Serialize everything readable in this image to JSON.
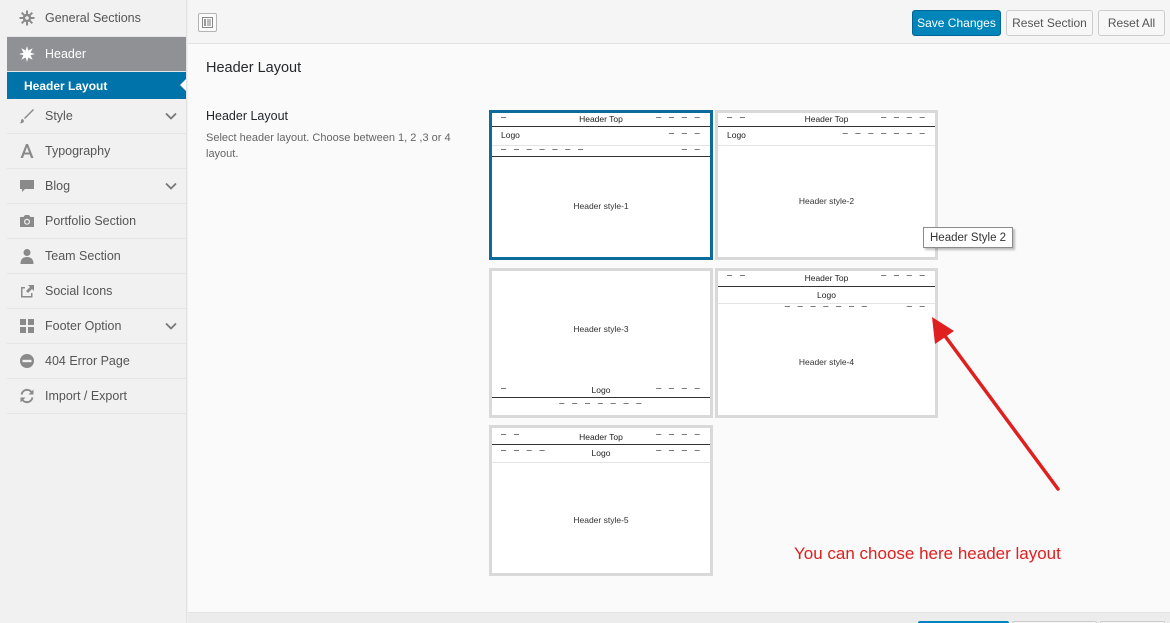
{
  "sidebar": {
    "items": [
      {
        "label": "General Sections",
        "icon": "gear-icon"
      },
      {
        "label": "Header",
        "icon": "burst-icon"
      },
      {
        "label": "Style",
        "icon": "brush-icon"
      },
      {
        "label": "Typography",
        "icon": "typography-icon"
      },
      {
        "label": "Blog",
        "icon": "comment-icon"
      },
      {
        "label": "Portfolio Section",
        "icon": "camera-icon"
      },
      {
        "label": "Team Section",
        "icon": "person-icon"
      },
      {
        "label": "Social Icons",
        "icon": "share-icon"
      },
      {
        "label": "Footer Option",
        "icon": "grid-icon"
      },
      {
        "label": "404 Error Page",
        "icon": "no-entry-icon"
      },
      {
        "label": "Import / Export",
        "icon": "refresh-icon"
      }
    ],
    "sub_item": {
      "label": "Header Layout"
    }
  },
  "toolbar": {
    "save_label": "Save Changes",
    "reset_section_label": "Reset Section",
    "reset_all_label": "Reset All"
  },
  "main": {
    "section_title": "Header Layout",
    "field_title": "Header Layout",
    "field_desc": "Select header layout. Choose between 1, 2 ,3 or 4 layout.",
    "tooltip": "Header Style 2",
    "selected_style": 1
  },
  "styles": [
    {
      "top": "Header Top",
      "logo": "Logo",
      "dashes_left": "–",
      "dashes_right": "– – – –",
      "menu": "— — —",
      "sub_left": "– – – – – – –",
      "sub_right": "– –",
      "label": "Header style-1"
    },
    {
      "top": "Header Top",
      "logo": "Logo",
      "dashes_left": "– –",
      "dashes_right": "– – – –",
      "menu": "– – – – – – –",
      "label": "Header style-2"
    },
    {
      "logo": "Logo",
      "dashes_left": "–",
      "dashes_right": "– – – –",
      "sub_center": "– – – – – – –",
      "label": "Header style-3"
    },
    {
      "top": "Header Top",
      "logo": "Logo",
      "dashes_left": "– –",
      "dashes_right": "– – – –",
      "sub_center": "– – – – – – –",
      "sub_right": "– –",
      "label": "Header style-4"
    },
    {
      "top": "Header Top",
      "logo": "Logo",
      "dashes_left": "– –",
      "dashes_right": "– – – –",
      "logo_left": "– – – –",
      "logo_right": "– – – –",
      "label": "Header style-5"
    }
  ],
  "annotation": {
    "text": "You can choose here header layout",
    "color": "#e0201f"
  },
  "colors": {
    "accent": "#0085ba",
    "selected_border": "#0c6b9a",
    "active_sidebar": "#8f9194",
    "sub_item": "#0073aa"
  }
}
